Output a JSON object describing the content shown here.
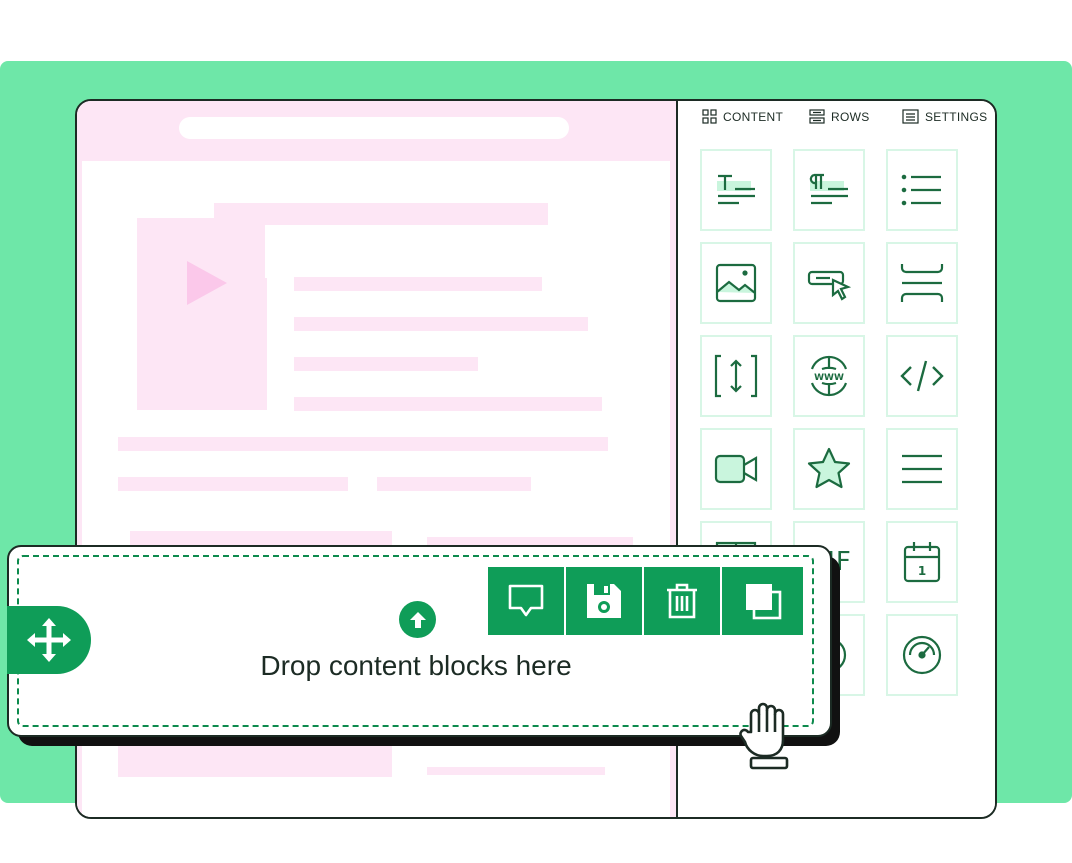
{
  "colors": {
    "background_green": "#6ee7a8",
    "accent_green": "#0f9d58",
    "dark_green": "#1c6b40",
    "placeholder_pink": "#fde6f5",
    "outline": "#1c2b24"
  },
  "panel": {
    "tabs": [
      {
        "label": "CONTENT",
        "icon": "grid-icon"
      },
      {
        "label": "ROWS",
        "icon": "rows-icon"
      },
      {
        "label": "SETTINGS",
        "icon": "settings-icon"
      }
    ],
    "blocks": [
      {
        "icon": "title-block-icon"
      },
      {
        "icon": "paragraph-block-icon"
      },
      {
        "icon": "list-block-icon"
      },
      {
        "icon": "image-block-icon"
      },
      {
        "icon": "button-block-icon"
      },
      {
        "icon": "divider-block-icon"
      },
      {
        "icon": "spacer-block-icon"
      },
      {
        "icon": "social-www-block-icon"
      },
      {
        "icon": "html-code-block-icon"
      },
      {
        "icon": "video-block-icon"
      },
      {
        "icon": "icon-star-block-icon"
      },
      {
        "icon": "menu-block-icon"
      },
      {
        "icon": "table-block-icon"
      },
      {
        "icon": "gif-block-icon",
        "text": "GIF"
      },
      {
        "icon": "calendar-block-icon",
        "text": "1"
      },
      {
        "icon": "help-block-icon",
        "text": "?"
      },
      {
        "icon": "placeholder-block-icon"
      },
      {
        "icon": "gauge-block-icon"
      }
    ]
  },
  "dropzone": {
    "text": "Drop content blocks here",
    "toolbar": [
      {
        "icon": "comment-icon"
      },
      {
        "icon": "save-icon"
      },
      {
        "icon": "trash-icon"
      },
      {
        "icon": "duplicate-icon"
      }
    ]
  }
}
